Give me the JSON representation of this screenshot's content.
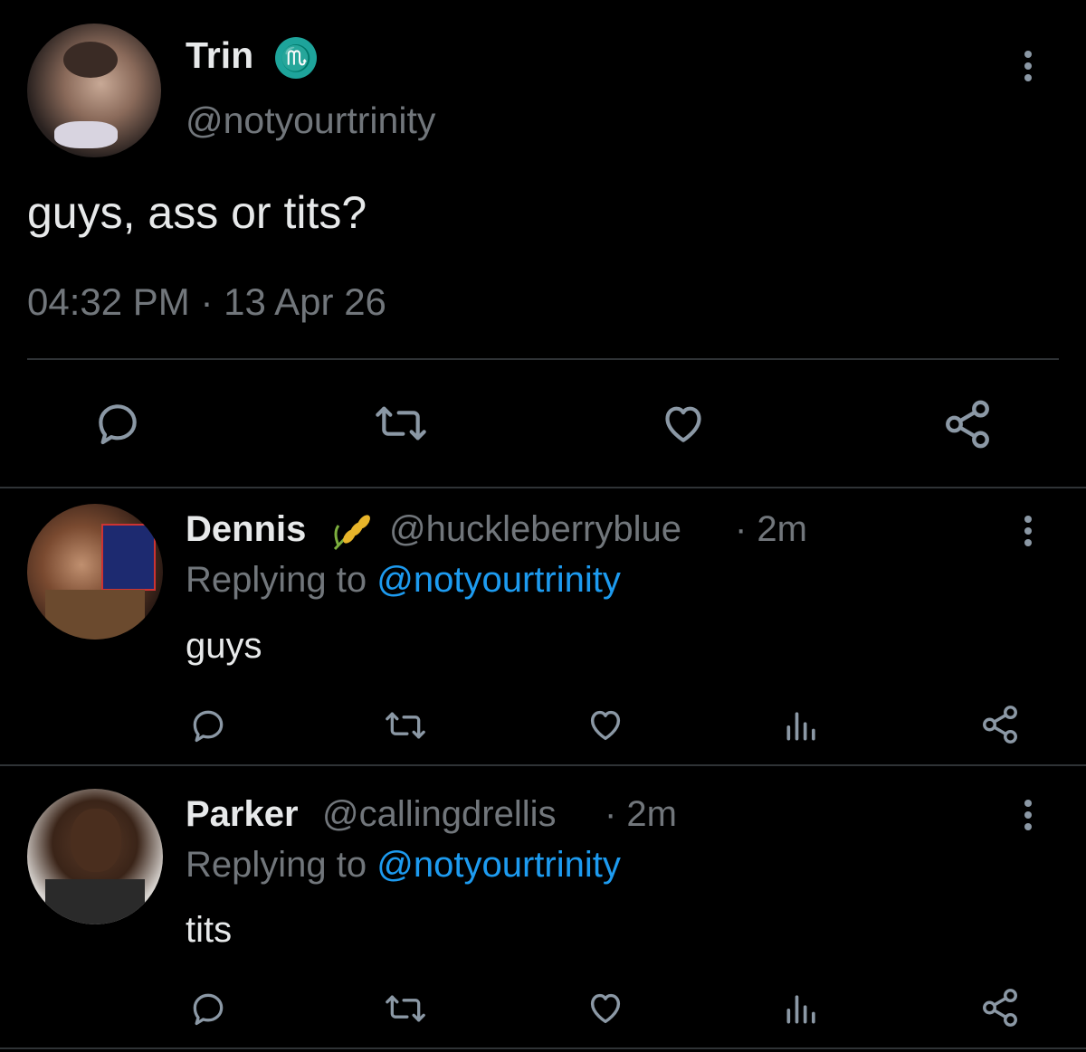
{
  "main_tweet": {
    "name": "Trin",
    "badge_icon": "scorpio-icon",
    "handle": "@notyourtrinity",
    "text": "guys, ass or tits?",
    "timestamp": "04:32 PM · 13 Apr 26",
    "actions": [
      "reply-icon",
      "retweet-icon",
      "like-icon",
      "share-icon"
    ]
  },
  "replies": [
    {
      "name": "Dennis",
      "badge_icon": "wheat-icon",
      "handle": "@huckleberryblue",
      "time": "· 2m",
      "replying_prefix": "Replying to ",
      "replying_to": "@notyourtrinity",
      "text": "guys"
    },
    {
      "name": "Parker",
      "handle": "@callingdrellis",
      "time": "· 2m",
      "replying_prefix": "Replying to ",
      "replying_to": "@notyourtrinity",
      "text": "tits"
    }
  ],
  "colors": {
    "background": "#000000",
    "text": "#e7e9ea",
    "secondary": "#71767b",
    "link": "#1d9bf0",
    "badge": "#1ea49b"
  }
}
